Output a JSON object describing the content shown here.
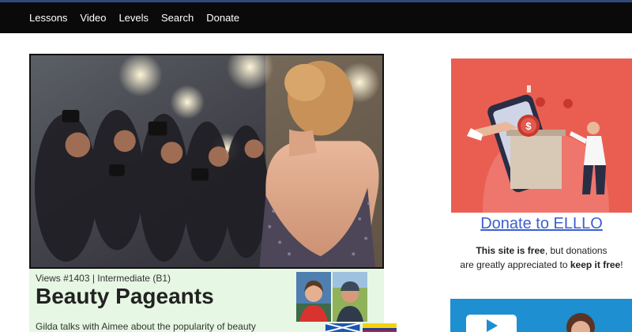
{
  "nav": {
    "items": [
      {
        "label": "Lessons"
      },
      {
        "label": "Video"
      },
      {
        "label": "Levels"
      },
      {
        "label": "Search"
      },
      {
        "label": "Donate"
      }
    ]
  },
  "lesson": {
    "meta": "Views #1403 | Intermediate (B1)",
    "title": "Beauty Pageants",
    "description": "Gilda talks with Aimee about the popularity of beauty"
  },
  "sidebar": {
    "donate_link": "Donate to ELLLO",
    "donate_text_1a": "This site is free",
    "donate_text_1b": ", but donations",
    "donate_text_2a": "are greatly appreciated to ",
    "donate_text_2b": "keep it free",
    "donate_text_2c": "!"
  },
  "colors": {
    "navbar": "#0a0a0a",
    "info_panel": "#e6f7e3",
    "donate_ad": "#ea5e52",
    "link": "#3b5fd0",
    "video_ad": "#1e8fd1"
  },
  "icons": {
    "play": "play-icon",
    "coin": "dollar-coin-icon"
  }
}
